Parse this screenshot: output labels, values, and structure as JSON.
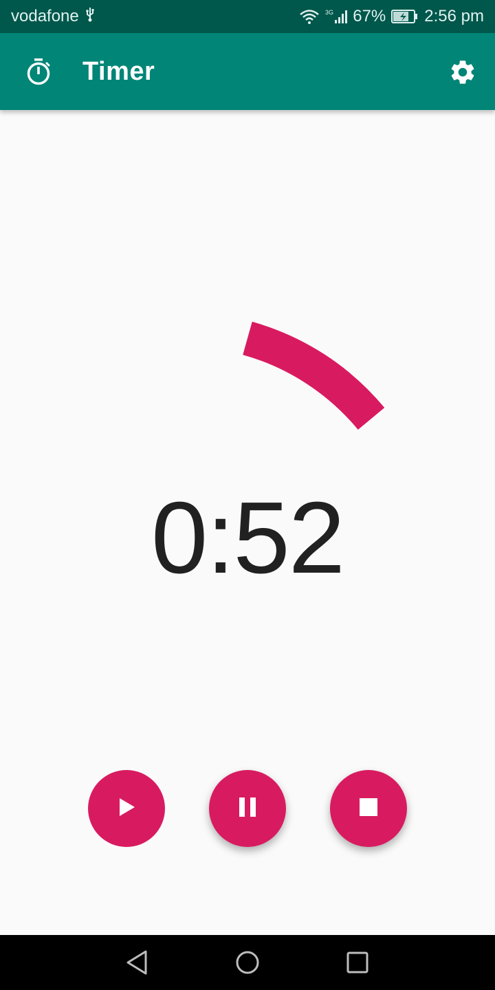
{
  "status_bar": {
    "carrier": "vodafone",
    "network": "3G",
    "battery": "67%",
    "time": "2:56 pm",
    "icons": [
      "usb-icon",
      "wifi-icon",
      "signal-icon",
      "battery-charging-icon"
    ]
  },
  "app_bar": {
    "title": "Timer",
    "icon": "stopwatch-icon",
    "action_icon": "gear-icon"
  },
  "timer": {
    "display": "0:52"
  },
  "controls": {
    "icons": [
      "play-icon",
      "pause-icon",
      "stop-icon"
    ]
  },
  "nav": {
    "icons": [
      "back-icon",
      "home-icon",
      "recents-icon"
    ]
  },
  "colors": {
    "status_bar": "#00574b",
    "app_bar": "#008577",
    "accent": "#d81b60",
    "background": "#fafafa",
    "text": "#212121"
  }
}
